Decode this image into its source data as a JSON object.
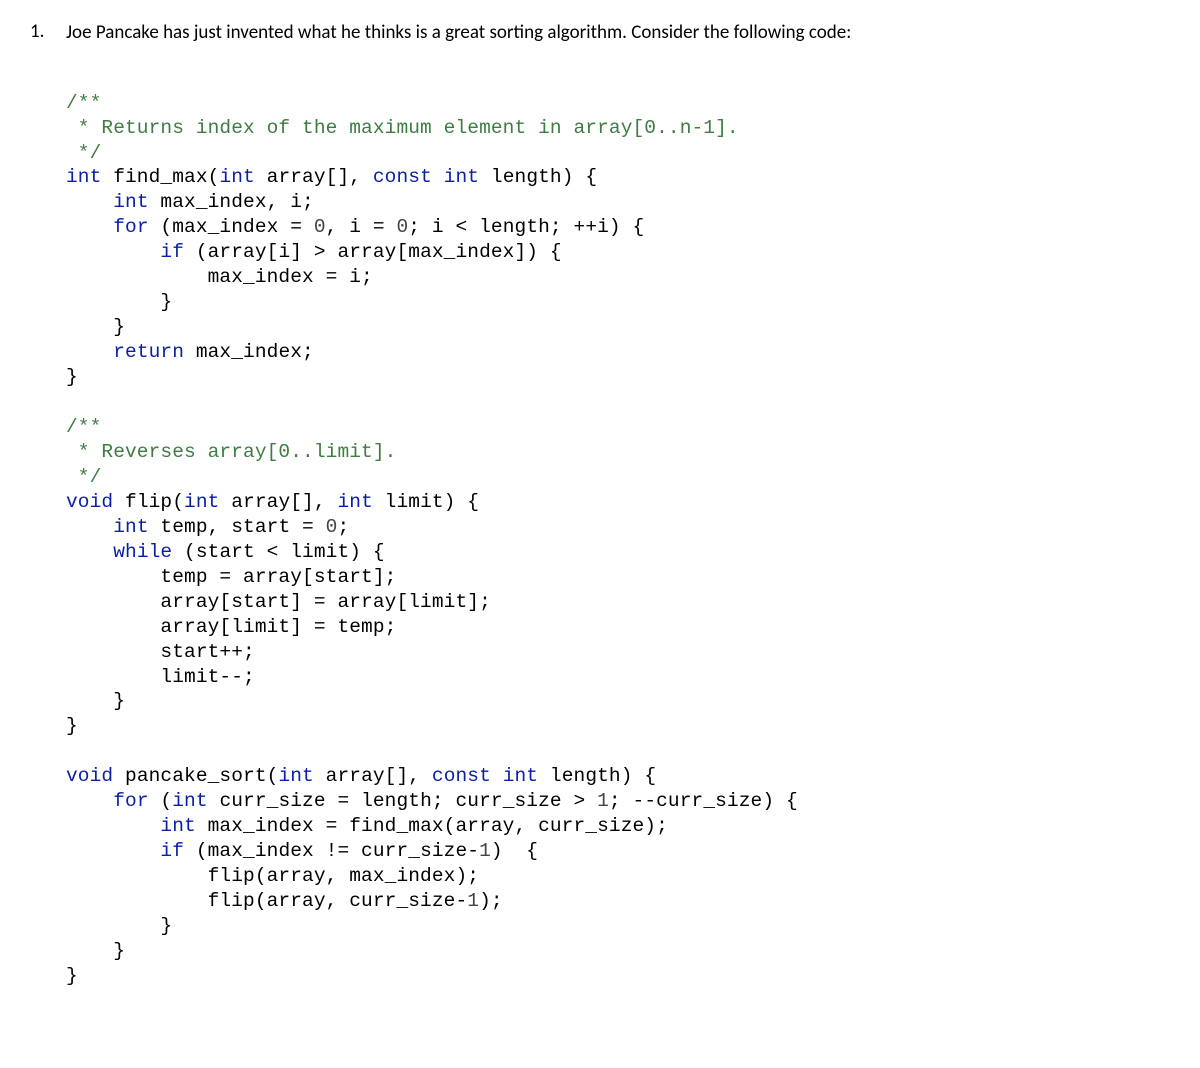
{
  "question": {
    "number": "1.",
    "text": "Joe Pancake has just invented what he thinks is a great sorting algorithm.  Consider the following code:"
  },
  "code": {
    "findmax": {
      "c1": "/**",
      "c2": " * Returns index of the maximum element in array[0..n-1].",
      "c3": " */",
      "sig_int": "int",
      "sig_name": " find_max(",
      "sig_p1t": "int",
      "sig_p1": " array[], ",
      "sig_const": "const",
      "sig_p2t": " int",
      "sig_p2": " length) {",
      "l1_int": "int",
      "l1_rest": " max_index, i;",
      "l2_for": "for",
      "l2_a": " (max_index = ",
      "l2_z1": "0",
      "l2_b": ", i = ",
      "l2_z2": "0",
      "l2_c": "; i < length; ++i) {",
      "l3_if": "if",
      "l3_rest": " (array[i] > array[max_index]) {",
      "l4": "            max_index = i;",
      "l5": "        }",
      "l6": "    }",
      "l7_ret": "return",
      "l7_rest": " max_index;",
      "l8": "}"
    },
    "flip": {
      "c1": "/**",
      "c2": " * Reverses array[0..limit].",
      "c3": " */",
      "sig_void": "void",
      "sig_name": " flip(",
      "sig_p1t": "int",
      "sig_p1": " array[], ",
      "sig_p2t": "int",
      "sig_p2": " limit) {",
      "l1_int": "int",
      "l1_rest": " temp, start = ",
      "l1_z": "0",
      "l1_semi": ";",
      "l2_while": "while",
      "l2_rest": " (start < limit) {",
      "l3": "        temp = array[start];",
      "l4": "        array[start] = array[limit];",
      "l5": "        array[limit] = temp;",
      "l6": "        start++;",
      "l7": "        limit--;",
      "l8": "    }",
      "l9": "}"
    },
    "ps": {
      "sig_void": "void",
      "sig_name": " pancake_sort(",
      "sig_p1t": "int",
      "sig_p1": " array[], ",
      "sig_const": "const",
      "sig_p2t": " int",
      "sig_p2": " length) {",
      "l1_for": "for",
      "l1_a": " (",
      "l1_int": "int",
      "l1_b": " curr_size = length; curr_size > ",
      "l1_one": "1",
      "l1_c": "; --curr_size) {",
      "l2_int": "int",
      "l2_rest": " max_index = find_max(array, curr_size);",
      "l3_if": "if",
      "l3_a": " (max_index != curr_size-",
      "l3_one": "1",
      "l3_b": ")  {",
      "l4": "            flip(array, max_index);",
      "l5a": "            flip(array, curr_size-",
      "l5one": "1",
      "l5b": ");",
      "l6": "        }",
      "l7": "    }",
      "l8": "}"
    }
  }
}
